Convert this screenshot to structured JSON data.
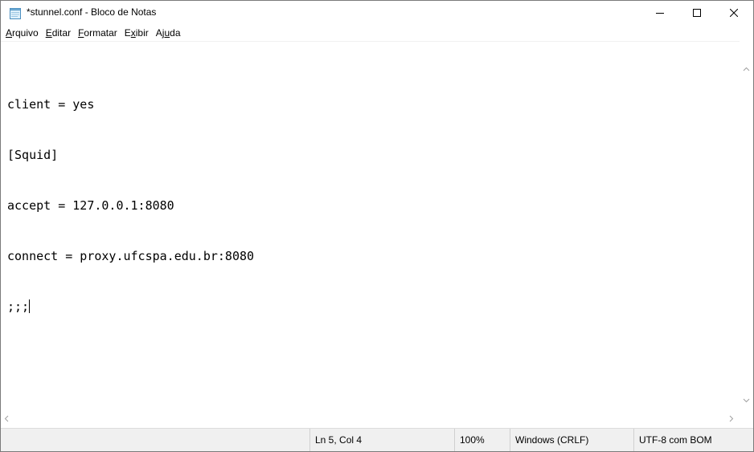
{
  "window": {
    "title": "*stunnel.conf - Bloco de Notas",
    "app_icon": "notepad-icon",
    "controls": {
      "minimize": "minimize-icon",
      "maximize": "maximize-icon",
      "close": "close-icon"
    }
  },
  "menu": [
    {
      "hotkey": "A",
      "rest": "rquivo"
    },
    {
      "hotkey": "E",
      "rest": "ditar"
    },
    {
      "hotkey": "F",
      "rest": "ormatar"
    },
    {
      "pre": "E",
      "hotkey": "x",
      "rest": "ibir"
    },
    {
      "pre": "Aj",
      "hotkey": "u",
      "rest": "da"
    }
  ],
  "editor": {
    "lines": [
      "client = yes",
      "[Squid]",
      "accept = 127.0.0.1:8080",
      "connect = proxy.ufcspa.edu.br:8080",
      ";;;"
    ]
  },
  "statusbar": {
    "position": "Ln 5, Col 4",
    "zoom": "100%",
    "line_ending": "Windows (CRLF)",
    "encoding": "UTF-8 com BOM"
  },
  "colors": {
    "status_bg": "#f0f0f0",
    "scroll_arrow": "#a0a0a0"
  }
}
